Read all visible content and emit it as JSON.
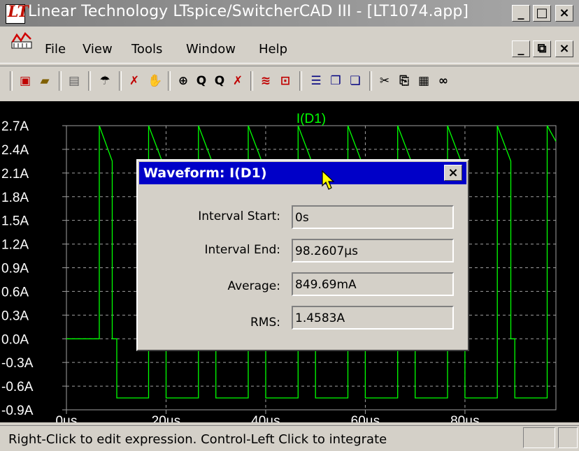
{
  "window": {
    "title": "Linear Technology LTspice/SwitcherCAD III - [LT1074.app]",
    "buttons": [
      "_",
      "□",
      "×"
    ]
  },
  "menubar": {
    "items": [
      {
        "label": "File",
        "accel": "F"
      },
      {
        "label": "View",
        "accel": "V"
      },
      {
        "label": "Tools",
        "accel": "T"
      },
      {
        "label": "Window",
        "accel": "W"
      },
      {
        "label": "Help",
        "accel": "H"
      }
    ],
    "doc_buttons": [
      "_",
      "⧉",
      "×"
    ]
  },
  "toolbar": {
    "icons": [
      "new-schematic-icon",
      "open-icon",
      "save-icon",
      "control-panel-icon",
      "run-icon",
      "pan-icon",
      "zoom-in-icon",
      "zoom-area-icon",
      "zoom-out-icon",
      "zoom-cancel-icon",
      "autorange-icon",
      "markers-icon",
      "tile-horizontal-icon",
      "cascade-icon",
      "tile-vertical-icon",
      "cut-icon",
      "copy-icon",
      "paste-icon",
      "find-icon"
    ]
  },
  "plot": {
    "trace_label": "I(D1)",
    "trace_color": "#00ff00",
    "background": "#000000"
  },
  "chart_data": {
    "type": "line",
    "title": "I(D1)",
    "xlabel": "",
    "ylabel": "",
    "xlim": [
      0,
      98.2607
    ],
    "ylim": [
      -0.9,
      2.7
    ],
    "x_ticks": [
      "0µs",
      "20µs",
      "40µs",
      "60µs",
      "80µs"
    ],
    "y_ticks": [
      "2.7A",
      "2.4A",
      "2.1A",
      "1.8A",
      "1.5A",
      "1.2A",
      "0.9A",
      "0.6A",
      "0.3A",
      "0.0A",
      "-0.3A",
      "-0.6A",
      "-0.9A"
    ],
    "grid": true,
    "series": [
      {
        "name": "I(D1)",
        "x": [
          0,
          6.6,
          6.6,
          9.2,
          9.2,
          10.1,
          10.1,
          16.5,
          16.5,
          19.2,
          19.2,
          20.0,
          20.0,
          26.5,
          26.5,
          29.2,
          29.2,
          30.0,
          30.0,
          36.5,
          36.5,
          39.2,
          39.2,
          40.0,
          40.0,
          46.5,
          46.5,
          49.2,
          49.2,
          50.0,
          50.0,
          56.5,
          56.5,
          59.2,
          59.2,
          60.0,
          60.0,
          66.5,
          66.5,
          69.2,
          69.2,
          70.0,
          70.0,
          76.5,
          76.5,
          79.2,
          79.2,
          80.0,
          80.0,
          86.5,
          86.5,
          89.2,
          89.2,
          90.0,
          90.0,
          96.5,
          96.5,
          98.26
        ],
        "y": [
          0.0,
          0.0,
          2.7,
          2.25,
          0.0,
          0.0,
          -0.75,
          -0.75,
          2.7,
          2.25,
          0.0,
          0.0,
          -0.75,
          -0.75,
          2.7,
          2.25,
          0.0,
          0.0,
          -0.75,
          -0.75,
          2.7,
          2.25,
          0.0,
          0.0,
          -0.75,
          -0.75,
          2.7,
          2.25,
          0.0,
          0.0,
          -0.75,
          -0.75,
          2.7,
          2.25,
          0.0,
          0.0,
          -0.75,
          -0.75,
          2.7,
          2.25,
          0.0,
          0.0,
          -0.75,
          -0.75,
          2.7,
          2.25,
          0.0,
          0.0,
          -0.75,
          -0.75,
          2.7,
          2.25,
          0.0,
          0.0,
          -0.75,
          -0.75,
          2.7,
          2.5
        ]
      }
    ]
  },
  "dialog": {
    "title": "Waveform: I(D1)",
    "close_label": "×",
    "rows": [
      {
        "label": "Interval Start:",
        "value": "0s"
      },
      {
        "label": "Interval End:",
        "value": "98.2607µs"
      },
      {
        "label": "Average:",
        "value": "849.69mA"
      },
      {
        "label": "RMS:",
        "value": "1.4583A"
      }
    ]
  },
  "status": {
    "text": "Right-Click to edit expression. Control-Left Click to integrate"
  }
}
